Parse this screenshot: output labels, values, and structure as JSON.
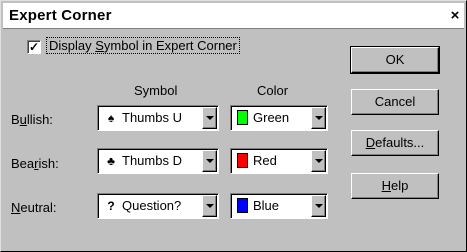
{
  "window": {
    "title": "Expert Corner",
    "close_glyph": "×"
  },
  "checkbox": {
    "checked": true,
    "check_glyph": "✓",
    "label_pre": "Display ",
    "label_mnemonic": "S",
    "label_post": "ymbol in Expert Corner"
  },
  "columns": {
    "symbol": "Symbol",
    "color": "Color"
  },
  "rows": [
    {
      "label_pre": "B",
      "label_mnemonic": "u",
      "label_post": "llish:",
      "symbol_glyph": "♠",
      "symbol_icon": "thumbs-up-icon",
      "symbol_value": "Thumbs U",
      "color_value": "Green",
      "color_hex": "#00ff00"
    },
    {
      "label_pre": "Bea",
      "label_mnemonic": "r",
      "label_post": "ish:",
      "symbol_glyph": "♣",
      "symbol_icon": "thumbs-down-icon",
      "symbol_value": "Thumbs D",
      "color_value": "Red",
      "color_hex": "#ff0000"
    },
    {
      "label_pre": "",
      "label_mnemonic": "N",
      "label_post": "eutral:",
      "symbol_glyph": "?",
      "symbol_icon": "question-icon",
      "symbol_value": "Question?",
      "color_value": "Blue",
      "color_hex": "#0000ff"
    }
  ],
  "buttons": {
    "ok": "OK",
    "cancel": "Cancel",
    "defaults_mnemonic": "D",
    "defaults_rest": "efaults...",
    "help_mnemonic": "H",
    "help_rest": "elp"
  }
}
